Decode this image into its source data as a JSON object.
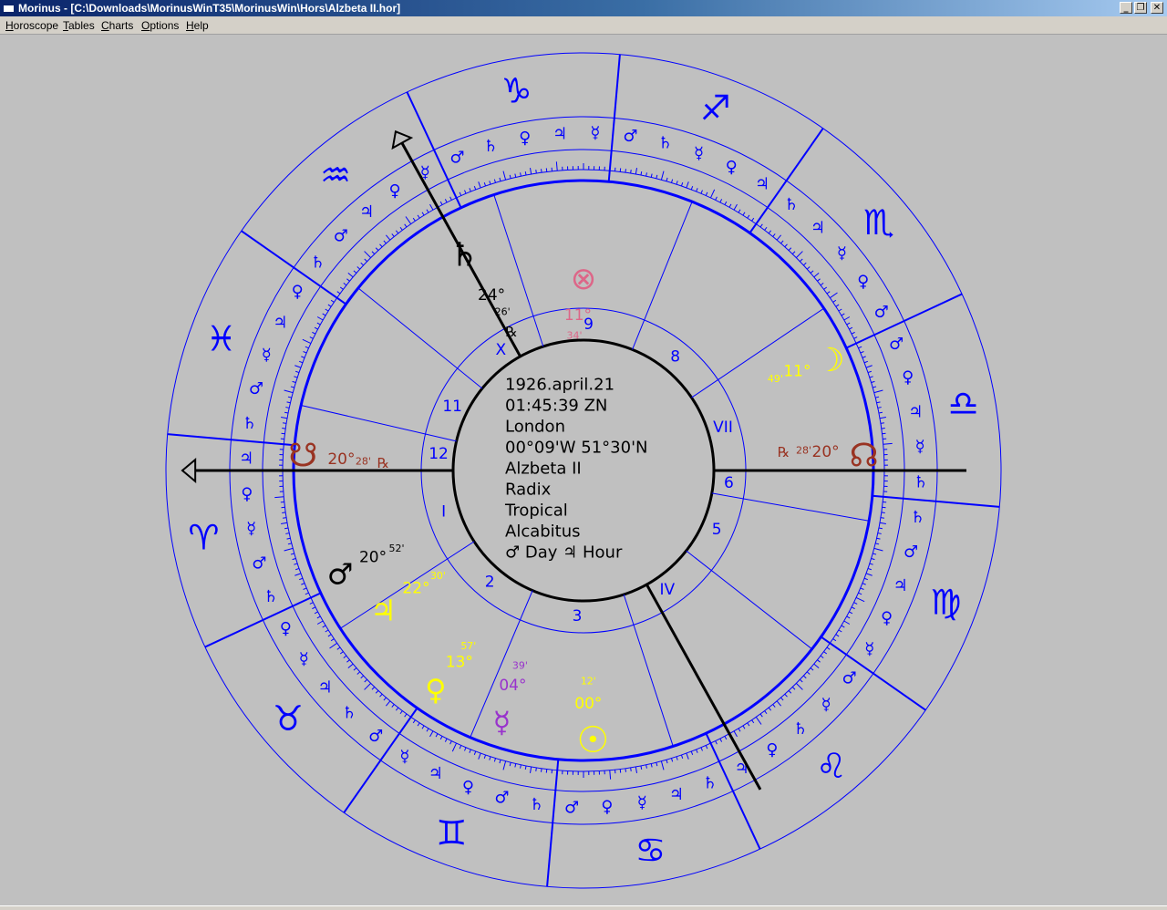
{
  "window": {
    "title": "Morinus - [C:\\Downloads\\MorinusWinT35\\MorinusWin\\Hors\\Alzbeta II.hor]",
    "minimize_glyph": "_",
    "restore_glyph": "❐",
    "close_glyph": "✕"
  },
  "menu": [
    {
      "underline": "H",
      "rest": "oroscope"
    },
    {
      "underline": "T",
      "rest": "ables"
    },
    {
      "underline": "C",
      "rest": "harts"
    },
    {
      "underline": "O",
      "rest": "ptions"
    },
    {
      "underline": "H",
      "rest": "elp"
    }
  ],
  "chart_info": [
    "1926.april.21",
    "01:45:39 ZN",
    "London",
    "00°09'W  51°30'N",
    "Alzbeta II",
    "Radix",
    "Tropical",
    "Alcabitus",
    "♂ Day  ♃ Hour"
  ],
  "colors": {
    "background": "#c0c0c0",
    "wheel": "#0000ff",
    "axis": "#000000",
    "sun": "#ffff00",
    "moon": "#ffff00",
    "jupiter": "#ffff00",
    "venus": "#ffff00",
    "mercury": "#9933cc",
    "mars": "#000000",
    "saturn": "#000000",
    "nodes": "#993322",
    "fortune": "#dd6688"
  },
  "signs": [
    "♈",
    "♉",
    "♊",
    "♋",
    "♌",
    "♍",
    "♎",
    "♏",
    "♐",
    "♑",
    "♒",
    "♓"
  ],
  "house_numbers": [
    "I",
    "2",
    "3",
    "IV",
    "5",
    "6",
    "VII",
    "8",
    "9",
    "X",
    "11",
    "12"
  ],
  "planets": [
    {
      "name": "sun",
      "glyph": "☉",
      "deg": "00°",
      "min": "12'",
      "retro": ""
    },
    {
      "name": "moon",
      "glyph": "☽",
      "deg": "11°",
      "min": "49'",
      "retro": ""
    },
    {
      "name": "mercury",
      "glyph": "☿",
      "deg": "04°",
      "min": "39'",
      "retro": ""
    },
    {
      "name": "venus",
      "glyph": "♀",
      "deg": "13°",
      "min": "57'",
      "retro": ""
    },
    {
      "name": "mars",
      "glyph": "♂",
      "deg": "20°",
      "min": "52'",
      "retro": ""
    },
    {
      "name": "jupiter",
      "glyph": "♃",
      "deg": "22°",
      "min": "30'",
      "retro": ""
    },
    {
      "name": "saturn",
      "glyph": "♄",
      "deg": "24°",
      "min": "26'",
      "retro": "℞"
    },
    {
      "name": "north-node",
      "glyph": "☊",
      "deg": "20°",
      "min": "28'",
      "retro": "℞"
    },
    {
      "name": "south-node",
      "glyph": "☋",
      "deg": "20°",
      "min": "28'",
      "retro": "℞"
    },
    {
      "name": "fortune",
      "glyph": "⊗",
      "deg": "11°",
      "min": "34'",
      "retro": ""
    }
  ],
  "terms": [
    {
      "sign": "♈",
      "glyphs": [
        "♃",
        "♀",
        "☿",
        "♂",
        "♄"
      ]
    },
    {
      "sign": "♉",
      "glyphs": [
        "♀",
        "☿",
        "♃",
        "♄",
        "♂"
      ]
    },
    {
      "sign": "♊",
      "glyphs": [
        "☿",
        "♃",
        "♀",
        "♂",
        "♄"
      ]
    },
    {
      "sign": "♋",
      "glyphs": [
        "♂",
        "♀",
        "☿",
        "♃",
        "♄"
      ]
    },
    {
      "sign": "♌",
      "glyphs": [
        "♃",
        "♀",
        "♄",
        "☿",
        "♂"
      ]
    },
    {
      "sign": "♍",
      "glyphs": [
        "☿",
        "♀",
        "♃",
        "♂",
        "♄"
      ]
    },
    {
      "sign": "♎",
      "glyphs": [
        "♄",
        "☿",
        "♃",
        "♀",
        "♂"
      ]
    },
    {
      "sign": "♏",
      "glyphs": [
        "♂",
        "♀",
        "☿",
        "♃",
        "♄"
      ]
    },
    {
      "sign": "♐",
      "glyphs": [
        "♃",
        "♀",
        "☿",
        "♄",
        "♂"
      ]
    },
    {
      "sign": "♑",
      "glyphs": [
        "☿",
        "♃",
        "♀",
        "♄",
        "♂"
      ]
    },
    {
      "sign": "♒",
      "glyphs": [
        "☿",
        "♀",
        "♃",
        "♂",
        "♄"
      ]
    },
    {
      "sign": "♓",
      "glyphs": [
        "♀",
        "♃",
        "☿",
        "♂",
        "♄"
      ]
    }
  ]
}
